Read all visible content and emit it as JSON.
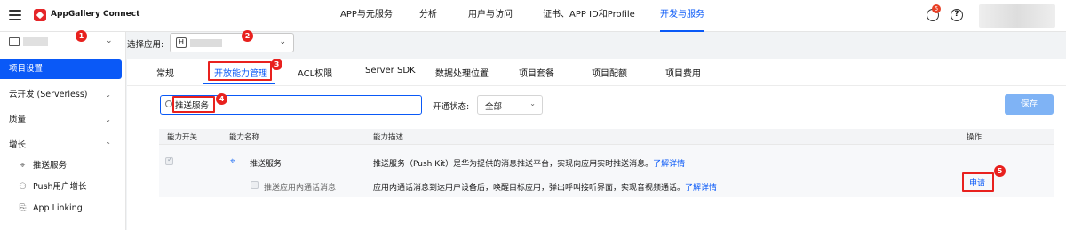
{
  "header": {
    "brand": "AppGallery Connect",
    "nav": [
      "APP与元服务",
      "分析",
      "用户与访问",
      "证书、APP ID和Profile",
      "开发与服务"
    ],
    "active_nav": "开发与服务",
    "notification_count": "5",
    "help_glyph": "?"
  },
  "project_selector": {
    "select_app_label": "选择应用:",
    "app_type_letter": "H"
  },
  "sidebar": {
    "items": [
      {
        "label": "项目设置",
        "active": true
      },
      {
        "label": "云开发 (Serverless)"
      },
      {
        "label": "质量"
      },
      {
        "label": "增长"
      }
    ],
    "growth_children": [
      "推送服务",
      "Push用户增长",
      "App Linking"
    ]
  },
  "tabs": [
    "常规",
    "开放能力管理",
    "ACL权限",
    "Server SDK",
    "数据处理位置",
    "项目套餐",
    "项目配额",
    "项目费用"
  ],
  "active_tab": "开放能力管理",
  "filter": {
    "search_value": "推送服务",
    "status_label": "开通状态:",
    "status_value": "全部",
    "save_label": "保存"
  },
  "table": {
    "headers": [
      "能力开关",
      "能力名称",
      "能力描述",
      "操作"
    ],
    "rows": [
      {
        "name": "推送服务",
        "description": "推送服务（Push Kit）是华为提供的消息推送平台，实现向应用实时推送消息。",
        "link": "了解详情"
      },
      {
        "name": "推送应用内通话消息",
        "description": "应用内通话消息到达用户设备后，唤醒目标应用，弹出呼叫接听界面，实现音视频通话。",
        "link": "了解详情",
        "action": "申请"
      }
    ]
  },
  "annotations": [
    "1",
    "2",
    "3",
    "4",
    "5"
  ],
  "colors": {
    "accent": "#0a59f7",
    "annotation": "#e8211e",
    "save_disabled": "#7fb3f5"
  }
}
